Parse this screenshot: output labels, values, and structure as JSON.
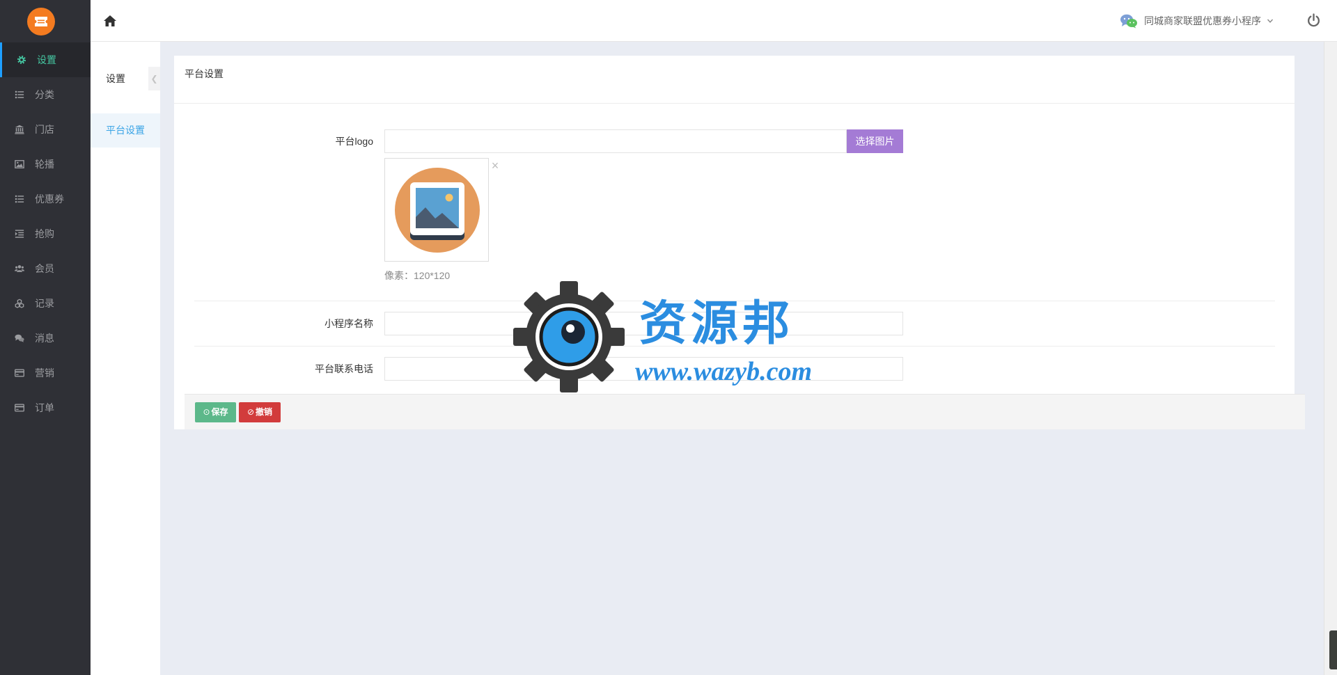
{
  "app": {
    "logo_icon": "ticket-icon"
  },
  "sidebar": {
    "items": [
      {
        "label": "设置",
        "icon": "gear-icon",
        "active": true
      },
      {
        "label": "分类",
        "icon": "list-icon"
      },
      {
        "label": "门店",
        "icon": "bank-icon"
      },
      {
        "label": "轮播",
        "icon": "image-icon"
      },
      {
        "label": "优惠券",
        "icon": "list-icon"
      },
      {
        "label": "抢购",
        "icon": "indent-list-icon"
      },
      {
        "label": "会员",
        "icon": "users-icon"
      },
      {
        "label": "记录",
        "icon": "cubes-icon"
      },
      {
        "label": "消息",
        "icon": "comments-icon"
      },
      {
        "label": "营销",
        "icon": "credit-card-icon"
      },
      {
        "label": "订单",
        "icon": "credit-card-icon"
      }
    ]
  },
  "header": {
    "home_icon": "home-icon",
    "account_icon": "wechat-icon",
    "account_name": "同城商家联盟优惠券小程序",
    "dropdown_icon": "chevron-down-icon",
    "logout_icon": "power-icon"
  },
  "subnav": {
    "title": "设置",
    "collapse_glyph": "❮",
    "items": [
      {
        "label": "平台设置",
        "active": true
      }
    ]
  },
  "card": {
    "title": "平台设置"
  },
  "form": {
    "logo": {
      "label": "平台logo",
      "value": "",
      "placeholder": "",
      "button_label": "选择图片",
      "preview_icon": "image-placeholder-icon",
      "remove_glyph": "×",
      "hint": "像素：120*120"
    },
    "app_name": {
      "label": "小程序名称",
      "value": "",
      "placeholder": ""
    },
    "phone": {
      "label": "平台联系电话",
      "value": "",
      "placeholder": ""
    }
  },
  "actions": {
    "save_icon": "⊙",
    "save_label": "保存",
    "cancel_icon": "⊘",
    "cancel_label": "撤销"
  },
  "watermark": {
    "name": "资源邦",
    "url": "www.wazyb.com"
  },
  "colors": {
    "sidebar_bg": "#2f3036",
    "sidebar_active_text": "#45c6a1",
    "sidebar_active_bar": "#1e9fff",
    "subnav_active_text": "#3aa4e6",
    "choose_button": "#a47bd5",
    "save_button": "#5cb88a",
    "cancel_button": "#d23c3c",
    "page_bg": "#e9ecf3",
    "logo_orange": "#f47b20",
    "watermark_blue": "#2b8de0"
  }
}
